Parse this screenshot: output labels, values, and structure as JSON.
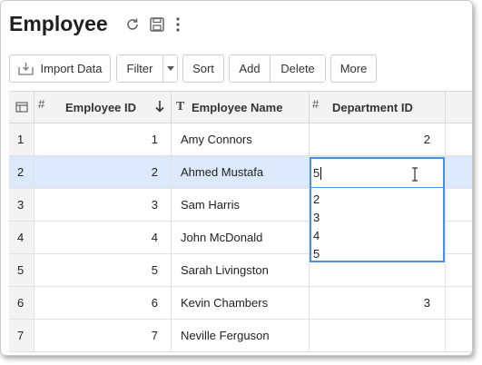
{
  "header": {
    "title": "Employee",
    "icons": [
      "refresh-icon",
      "save-icon",
      "more-vertical-icon"
    ]
  },
  "toolbar": {
    "import_label": "Import Data",
    "filter_label": "Filter",
    "sort_label": "Sort",
    "add_label": "Add",
    "delete_label": "Delete",
    "more_label": "More"
  },
  "grid": {
    "columns": [
      {
        "type_marker": "#",
        "label": "Employee ID",
        "sort": "descending"
      },
      {
        "type_marker": "T",
        "label": "Employee Name"
      },
      {
        "type_marker": "#",
        "label": "Department ID"
      }
    ],
    "rows": [
      {
        "num": "1",
        "id": "1",
        "name": "Amy Connors",
        "dept": "2"
      },
      {
        "num": "2",
        "id": "2",
        "name": "Ahmed Mustafa",
        "dept": ""
      },
      {
        "num": "3",
        "id": "3",
        "name": "Sam Harris",
        "dept": ""
      },
      {
        "num": "4",
        "id": "4",
        "name": "John McDonald",
        "dept": ""
      },
      {
        "num": "5",
        "id": "5",
        "name": "Sarah Livingston",
        "dept": ""
      },
      {
        "num": "6",
        "id": "6",
        "name": "Kevin Chambers",
        "dept": "3"
      },
      {
        "num": "7",
        "id": "7",
        "name": "Neville Ferguson",
        "dept": ""
      }
    ],
    "selected_row": 2
  },
  "editor": {
    "value": "5",
    "options": [
      "2",
      "3",
      "4",
      "5"
    ]
  },
  "colors": {
    "accent": "#4a90e2",
    "selected_row": "#dbe9fb",
    "header_bg": "#f3f3f3"
  }
}
